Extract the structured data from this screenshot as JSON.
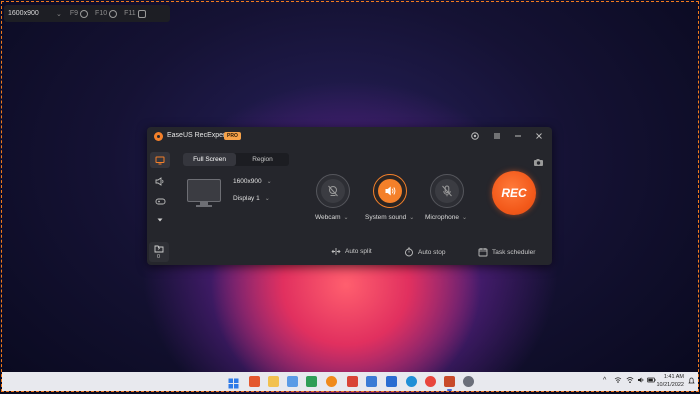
{
  "region_toolbar": {
    "resolution": "1600x900",
    "hotkeys": [
      "F9",
      "F10",
      "F11"
    ]
  },
  "app": {
    "title": "EaseUS RecExperts",
    "badge": "PRO",
    "tabs": [
      {
        "label": "Full Screen",
        "active": true
      },
      {
        "label": "Region",
        "active": false
      }
    ],
    "screen": {
      "resolution": "1600x900",
      "display": "Display 1"
    },
    "sources": [
      {
        "label": "Webcam",
        "state": "off",
        "icon": "webcam-off-icon"
      },
      {
        "label": "System sound",
        "state": "on",
        "icon": "speaker-icon"
      },
      {
        "label": "Microphone",
        "state": "off",
        "icon": "microphone-off-icon"
      }
    ],
    "rec_label": "REC",
    "file_count": "0",
    "bottom_actions": {
      "auto_split": "Auto split",
      "auto_stop": "Auto stop",
      "task_scheduler": "Task scheduler"
    },
    "accent_color": "#f4802a"
  },
  "taskbar": {
    "time": "1:41 AM",
    "date": "10/21/2022"
  }
}
